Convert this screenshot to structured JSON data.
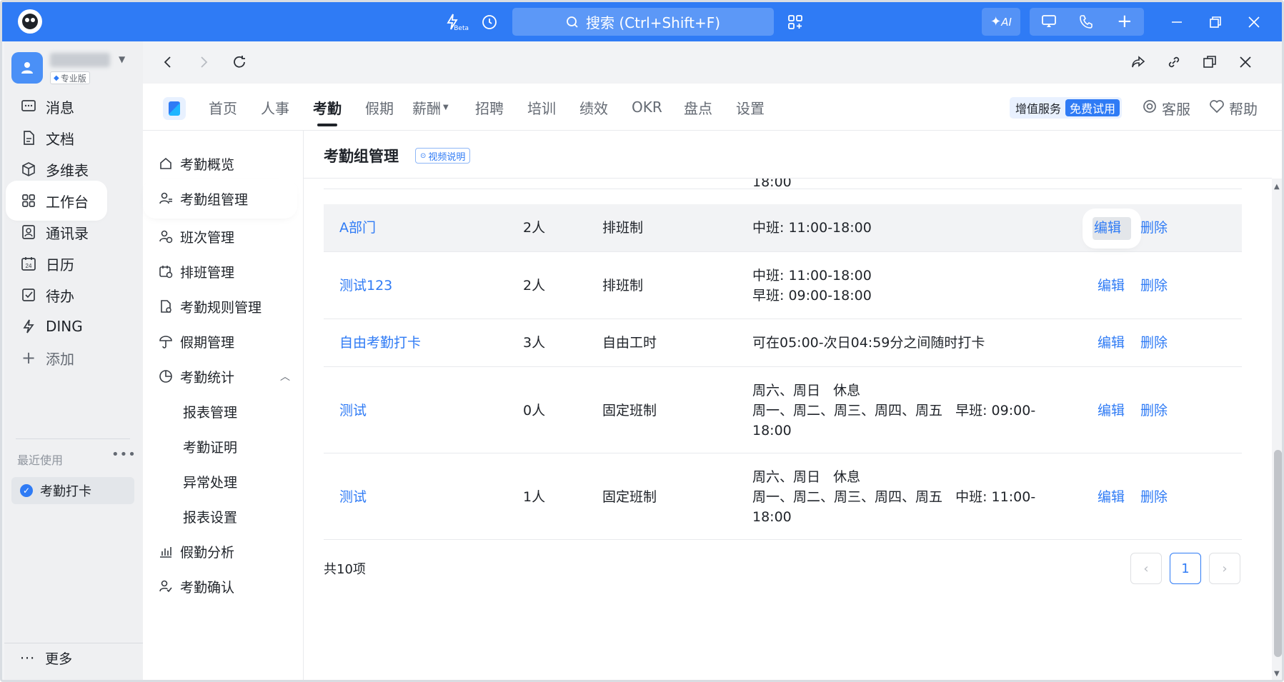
{
  "titlebar": {
    "search_placeholder": "搜索 (Ctrl+Shift+F)",
    "beta_label": "Beta",
    "ai_label": "AI"
  },
  "org": {
    "badge": "专业版"
  },
  "leftnav": {
    "items": [
      {
        "label": "消息",
        "icon": "message-icon"
      },
      {
        "label": "文档",
        "icon": "doc-icon"
      },
      {
        "label": "多维表",
        "icon": "cube-icon"
      },
      {
        "label": "工作台",
        "icon": "grid-icon"
      },
      {
        "label": "通讯录",
        "icon": "contact-icon"
      },
      {
        "label": "日历",
        "icon": "calendar-icon"
      },
      {
        "label": "待办",
        "icon": "todo-icon"
      },
      {
        "label": "DING",
        "icon": "lightning-icon"
      },
      {
        "label": "添加",
        "icon": "plus-icon"
      }
    ],
    "recent_title": "最近使用",
    "recent_item": "考勤打卡",
    "more_label": "更多"
  },
  "apphead": {
    "tabs": [
      "首页",
      "人事",
      "考勤",
      "假期",
      "薪酬",
      "招聘",
      "培训",
      "绩效",
      "OKR",
      "盘点",
      "设置"
    ],
    "active_tab": "考勤",
    "vas_label": "增值服务",
    "free_trial": "免费试用",
    "service_label": "客服",
    "help_label": "帮助"
  },
  "subnav": {
    "items": [
      {
        "label": "考勤概览",
        "icon": "home-icon"
      },
      {
        "label": "考勤组管理",
        "icon": "group-icon"
      },
      {
        "label": "班次管理",
        "icon": "shift-icon"
      },
      {
        "label": "排班管理",
        "icon": "schedule-icon"
      },
      {
        "label": "考勤规则管理",
        "icon": "rule-icon"
      },
      {
        "label": "假期管理",
        "icon": "umbrella-icon"
      },
      {
        "label": "考勤统计",
        "icon": "pie-icon"
      },
      {
        "label": "报表管理"
      },
      {
        "label": "考勤证明"
      },
      {
        "label": "异常处理"
      },
      {
        "label": "报表设置"
      },
      {
        "label": "假勤分析",
        "icon": "bar-chart-icon"
      },
      {
        "label": "考勤确认",
        "icon": "user-check-icon"
      }
    ]
  },
  "content": {
    "title": "考勤组管理",
    "video_link": "视频说明",
    "cut_off_text": "18:00",
    "rows": [
      {
        "name": "A部门",
        "count": "2人",
        "type": "排班制",
        "shift": [
          "中班: 11:00-18:00"
        ],
        "edit": "编辑",
        "del": "删除"
      },
      {
        "name": "测试123",
        "count": "2人",
        "type": "排班制",
        "shift": [
          "中班: 11:00-18:00",
          "早班: 09:00-18:00"
        ],
        "edit": "编辑",
        "del": "删除"
      },
      {
        "name": "自由考勤打卡",
        "count": "3人",
        "type": "自由工时",
        "shift": [
          "可在05:00-次日04:59分之间随时打卡"
        ],
        "edit": "编辑",
        "del": "删除"
      },
      {
        "name": "测试",
        "count": "0人",
        "type": "固定班制",
        "shift": [
          "周六、周日   休息",
          "周一、周二、周三、周四、周五   早班: 09:00-",
          "18:00"
        ],
        "edit": "编辑",
        "del": "删除"
      },
      {
        "name": "测试",
        "count": "1人",
        "type": "固定班制",
        "shift": [
          "周六、周日   休息",
          "周一、周二、周三、周四、周五   中班: 11:00-",
          "18:00"
        ],
        "edit": "编辑",
        "del": "删除"
      }
    ],
    "total": "共10项",
    "current_page": "1"
  },
  "colors": {
    "brand_blue": "#2f7bf5",
    "link_blue": "#2f7bf5"
  }
}
